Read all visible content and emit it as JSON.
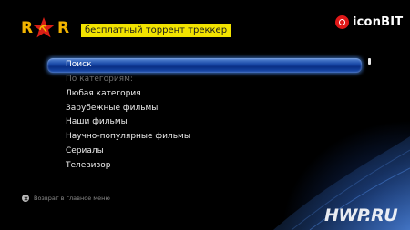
{
  "header": {
    "logo_text": "RYOR",
    "logo_left": "R",
    "logo_right": "R",
    "tagline": "бесплатный торрент треккер",
    "brand": "iconBIT"
  },
  "menu": {
    "items": [
      {
        "label": "Поиск",
        "state": "selected"
      },
      {
        "label": "По категориям:",
        "state": "disabled"
      },
      {
        "label": "Любая категория",
        "state": "normal"
      },
      {
        "label": "Зарубежные фильмы",
        "state": "normal"
      },
      {
        "label": "Наши фильмы",
        "state": "normal"
      },
      {
        "label": "Научно-популярные фильмы",
        "state": "normal"
      },
      {
        "label": "Сериалы",
        "state": "normal"
      },
      {
        "label": "Телевизор",
        "state": "normal"
      }
    ]
  },
  "footer": {
    "back_label": "Возврат в главное меню"
  },
  "watermark": "HWP.RU",
  "colors": {
    "accent_yellow": "#f2e300",
    "logo_gold": "#f2b400",
    "logo_red": "#d81e16",
    "brand_red": "#e01818",
    "selection_blue": "#1a4aa8"
  }
}
